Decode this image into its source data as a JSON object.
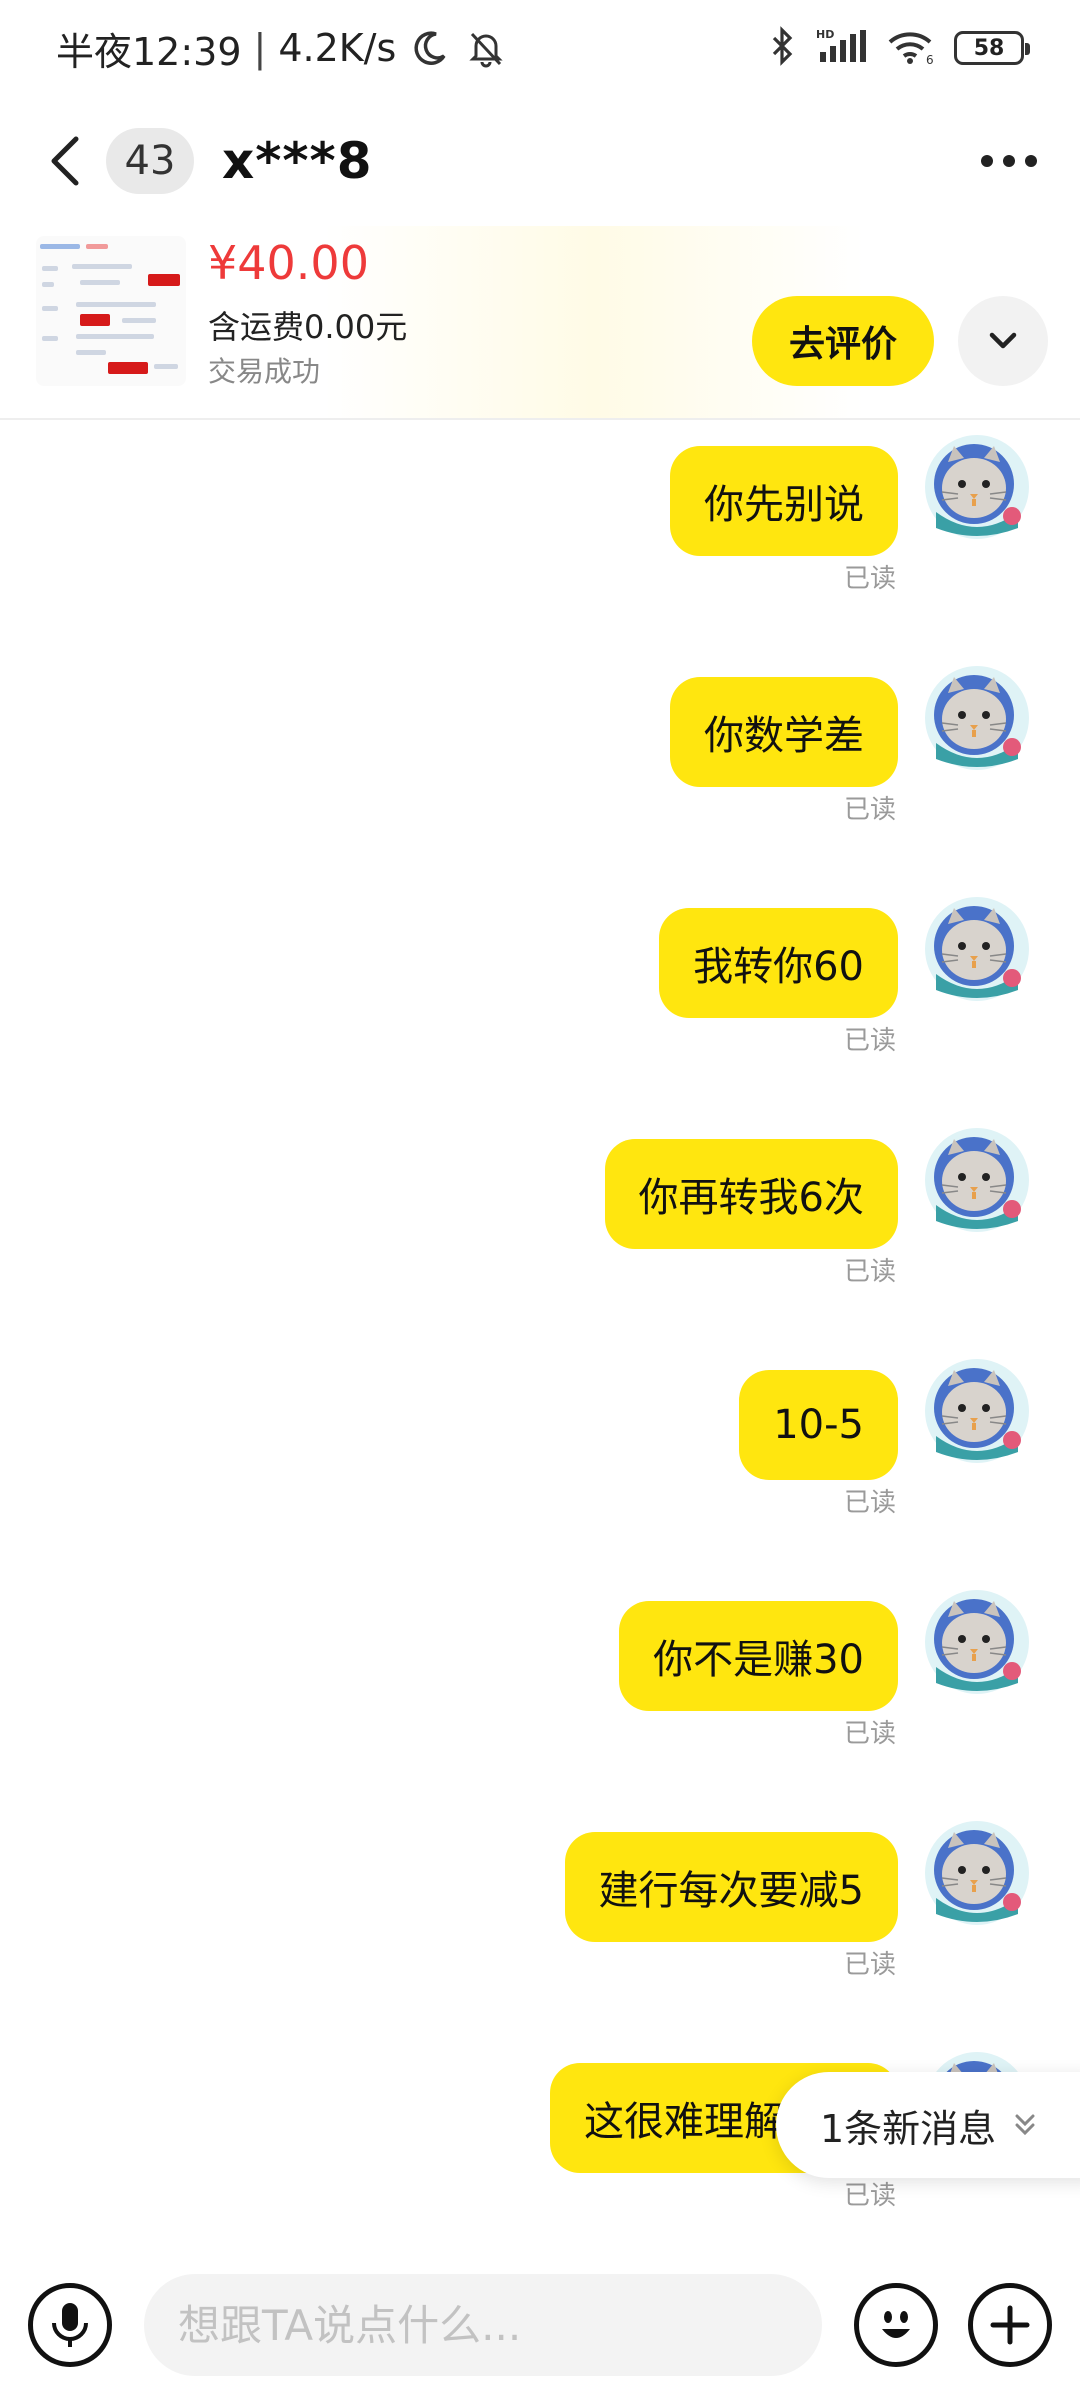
{
  "status_bar": {
    "time": "半夜12:39",
    "separator": "|",
    "speed": "4.2K/s",
    "battery": "58"
  },
  "header": {
    "unread_count": "43",
    "peer_name": "x***8"
  },
  "product": {
    "price": "¥40.00",
    "shipping": "含运费0.00元",
    "status": "交易成功",
    "review_button": "去评价"
  },
  "messages": [
    {
      "text": "你先别说",
      "status": "已读"
    },
    {
      "text": "你数学差",
      "status": "已读"
    },
    {
      "text": "我转你60",
      "status": "已读"
    },
    {
      "text": "你再转我6次",
      "status": "已读"
    },
    {
      "text": "10-5",
      "status": "已读"
    },
    {
      "text": "你不是赚30",
      "status": "已读"
    },
    {
      "text": "建行每次要减5",
      "status": "已读"
    },
    {
      "text": "这很难理解吗？",
      "status": "已读"
    }
  ],
  "new_messages": "1条新消息",
  "input": {
    "placeholder": "想跟TA说点什么..."
  },
  "colors": {
    "accent_yellow": "#ffe60f",
    "price_red": "#ee3a3a"
  }
}
